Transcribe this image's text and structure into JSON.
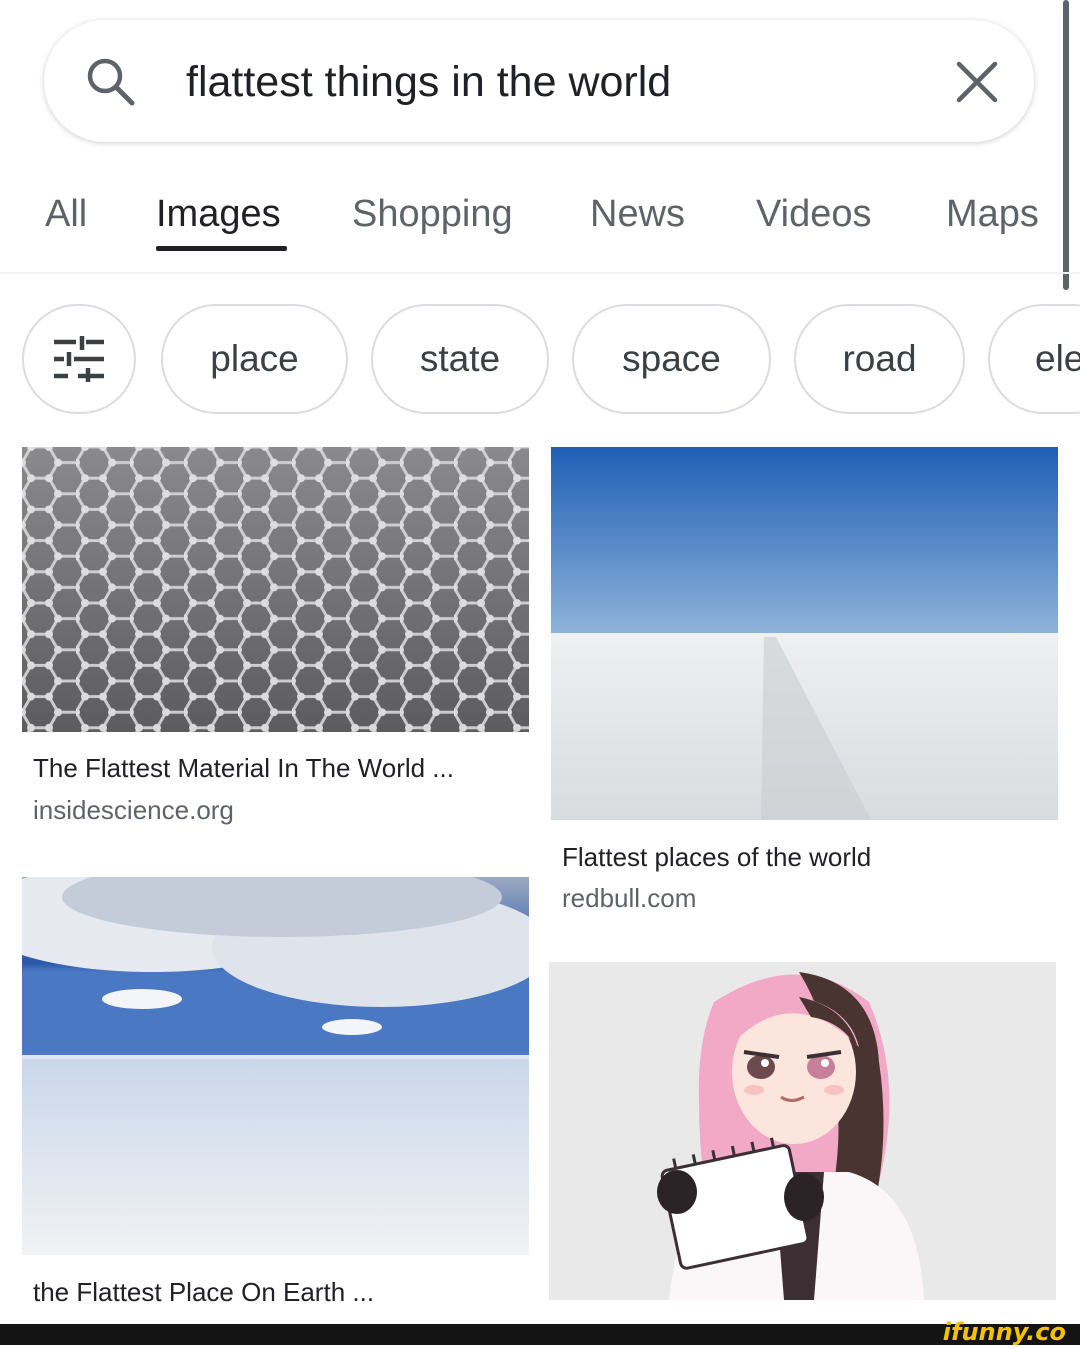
{
  "search": {
    "query": "flattest things in the world"
  },
  "tabs": [
    {
      "label": "All"
    },
    {
      "label": "Images"
    },
    {
      "label": "Shopping"
    },
    {
      "label": "News"
    },
    {
      "label": "Videos"
    },
    {
      "label": "Maps"
    }
  ],
  "chips": [
    {
      "label": "place"
    },
    {
      "label": "state"
    },
    {
      "label": "space"
    },
    {
      "label": "road"
    },
    {
      "label": "ele"
    }
  ],
  "results": [
    {
      "caption": "The Flattest Material In The World ...",
      "source": "insidescience.org"
    },
    {
      "caption": "Flattest places of the world",
      "source": "redbull.com"
    },
    {
      "caption": "the Flattest Place On Earth ...",
      "source": ""
    }
  ],
  "brand": {
    "logo_text": "ifunny.co"
  },
  "colors": {
    "accent": "#202124",
    "brand": "#f2c200"
  }
}
